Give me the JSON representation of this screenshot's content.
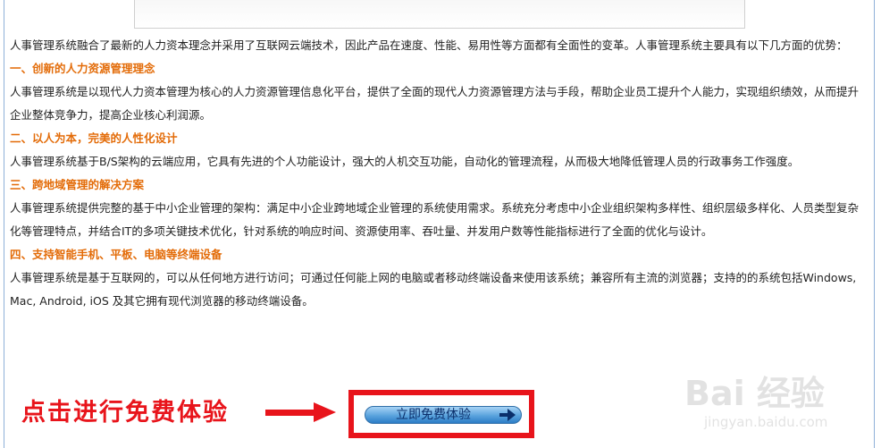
{
  "intro": "人事管理系统融合了最新的人力资本理念并采用了互联网云端技术，因此产品在速度、性能、易用性等方面都有全面性的变革。人事管理系统主要具有以下几方面的优势：",
  "sections": [
    {
      "heading": "一、创新的人力资源管理理念",
      "body": "人事管理系统是以现代人力资本管理为核心的人力资源管理信息化平台，提供了全面的现代人力资源管理方法与手段，帮助企业员工提升个人能力，实现组织绩效，从而提升企业整体竞争力，提高企业核心利润源。"
    },
    {
      "heading": "二、以人为本，完美的人性化设计",
      "body": "人事管理系统基于B/S架构的云端应用，它具有先进的个人功能设计，强大的人机交互功能，自动化的管理流程，从而极大地降低管理人员的行政事务工作强度。"
    },
    {
      "heading": "三、跨地域管理的解决方案",
      "body": "人事管理系统提供完整的基于中小企业管理的架构：满足中小企业跨地域企业管理的系统使用需求。系统充分考虑中小企业组织架构多样性、组织层级多样化、人员类型复杂化等管理特点，并结合IT的多项关键技术优化，针对系统的响应时间、资源使用率、吞吐量、并发用户数等性能指标进行了全面的优化与设计。"
    },
    {
      "heading": "四、支持智能手机、平板、电脑等终端设备",
      "body": "人事管理系统是基于互联网的，可以从任何地方进行访问；可通过任何能上网的电脑或者移动终端设备来使用该系统；兼容所有主流的浏览器；支持的的系统包括Windows, Mac, Android, iOS 及其它拥有现代浏览器的移动终端设备。"
    }
  ],
  "cta": {
    "callout": "点击进行免费体验",
    "button_label": "立即免费体验"
  },
  "watermark": {
    "logo": "Bai 经验",
    "url": "jingyan.baidu.com"
  },
  "colors": {
    "heading": "#e36c09",
    "callout": "#e8141b",
    "button": "#5aa3dd"
  },
  "icons": [
    "arrow-right-icon",
    "button-arrow-icon",
    "baidu-paw-icon"
  ]
}
